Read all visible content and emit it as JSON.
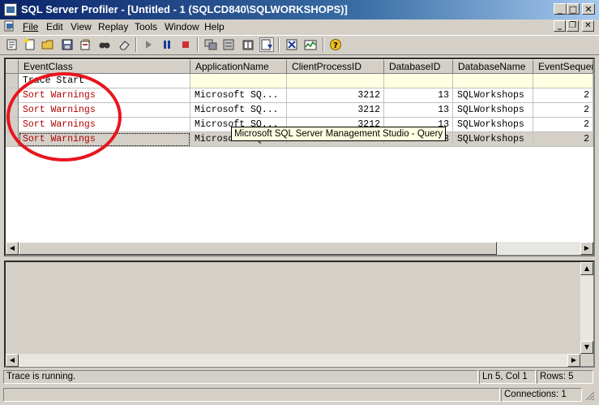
{
  "window": {
    "title": "SQL Server Profiler - [Untitled - 1 (SQLCD840\\SQLWORKSHOPS)]"
  },
  "title_buttons": {
    "minimize": "_",
    "maximize": "□",
    "close": "✕"
  },
  "mdi_buttons": {
    "minimize": "_",
    "restore": "❐",
    "close": "✕"
  },
  "menu": [
    {
      "label": "File"
    },
    {
      "label": "Edit"
    },
    {
      "label": "View"
    },
    {
      "label": "Replay"
    },
    {
      "label": "Tools"
    },
    {
      "label": "Window"
    },
    {
      "label": "Help"
    }
  ],
  "toolbar_icons": [
    "properties-icon",
    "new-trace-icon",
    "open-icon",
    "save-icon",
    "open-template-icon",
    "find-icon",
    "clear-trace-icon",
    "start-trace-icon",
    "pause-trace-icon",
    "stop-trace-icon",
    "correlate-icon",
    "performance-icon",
    "capture-icon",
    "autoscroll-icon",
    "trace-properties-icon",
    "help-icon"
  ],
  "grid": {
    "columns": [
      "EventClass",
      "ApplicationName",
      "ClientProcessID",
      "DatabaseID",
      "DatabaseName",
      "EventSequence"
    ],
    "rows": [
      {
        "event": "Trace Start",
        "app": "",
        "pid": "",
        "dbid": "",
        "dbname": "",
        "seq": ""
      },
      {
        "event": "Sort Warnings",
        "app": "Microsoft SQ...",
        "pid": "3212",
        "dbid": "13",
        "dbname": "SQLWorkshops",
        "seq": "2"
      },
      {
        "event": "Sort Warnings",
        "app": "Microsoft SQ...",
        "pid": "3212",
        "dbid": "13",
        "dbname": "SQLWorkshops",
        "seq": "2"
      },
      {
        "event": "Sort Warnings",
        "app": "Microsoft SQ...",
        "pid": "3212",
        "dbid": "13",
        "dbname": "SQLWorkshops",
        "seq": "2"
      },
      {
        "event": "Sort Warnings",
        "app": "Microsoft SQ...",
        "pid": "3212",
        "dbid": "13",
        "dbname": "SQLWorkshops",
        "seq": "2"
      }
    ]
  },
  "tooltip": "Microsoft SQL Server Management Studio - Query",
  "status": {
    "message": "Trace is running.",
    "position": "Ln 5, Col 1",
    "rows": "Rows: 5",
    "connections": "Connections: 1"
  },
  "colors": {
    "event_red": "#b00000",
    "annotation_red": "#e8141e",
    "title_start": "#0a246a"
  }
}
